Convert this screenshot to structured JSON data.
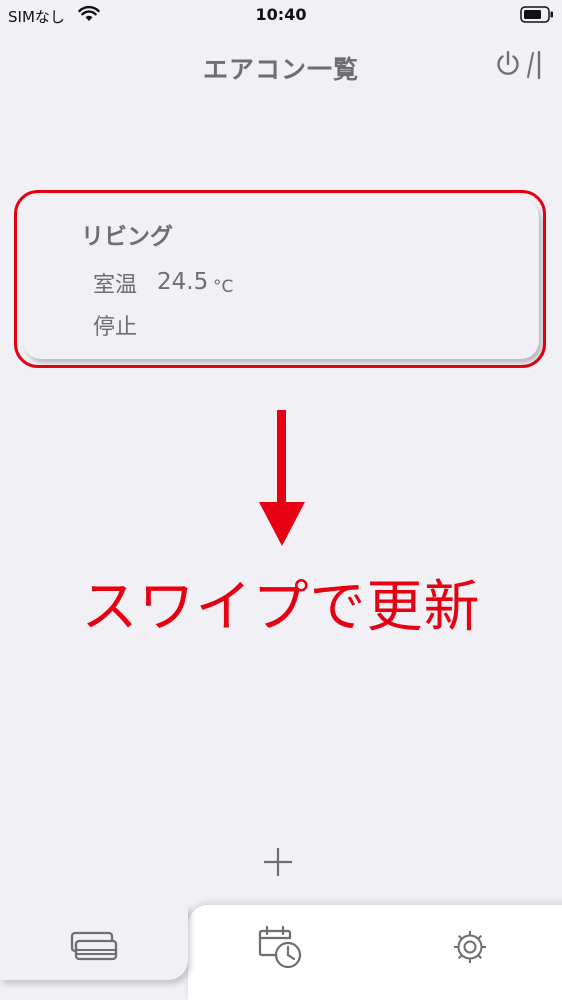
{
  "status_bar": {
    "carrier": "SIMなし",
    "time": "10:40",
    "icons": [
      "wifi-icon",
      "battery-icon"
    ]
  },
  "header": {
    "title": "エアコン一覧",
    "power_icon": "power-icon"
  },
  "aircon_list": [
    {
      "name": "リビング",
      "temp_label": "室温",
      "temp_value": "24.5",
      "temp_unit": "°C",
      "status": "停止"
    }
  ],
  "annotation": {
    "text": "スワイプで更新",
    "color": "#e60012",
    "icon": "arrow-down-icon"
  },
  "add_button": {
    "icon": "plus-icon"
  },
  "tab_bar": {
    "tabs": [
      {
        "icon": "aircon-list-icon",
        "active": true
      },
      {
        "icon": "calendar-timer-icon",
        "active": false
      },
      {
        "icon": "gear-icon",
        "active": false
      }
    ]
  },
  "colors": {
    "background": "#f1f0f5",
    "text": "#6e6e72",
    "highlight": "#e60012"
  }
}
